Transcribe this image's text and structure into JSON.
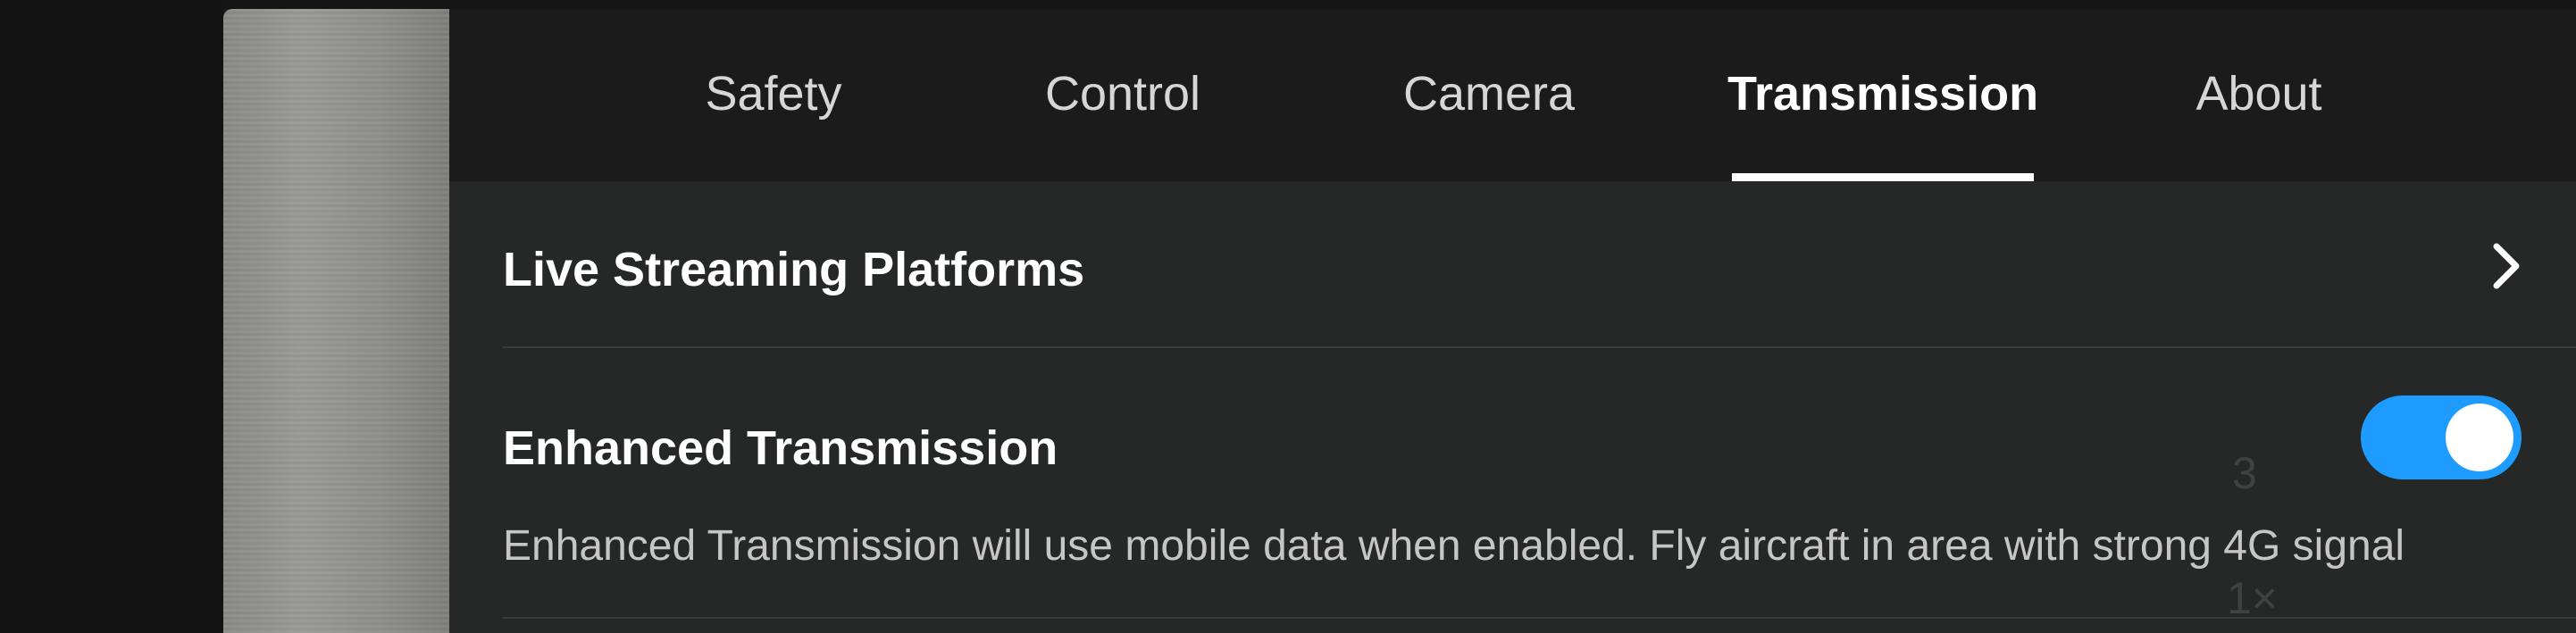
{
  "tabs": [
    {
      "label": "Safety",
      "active": false
    },
    {
      "label": "Control",
      "active": false
    },
    {
      "label": "Camera",
      "active": false
    },
    {
      "label": "Transmission",
      "active": true
    },
    {
      "label": "About",
      "active": false
    }
  ],
  "rows": {
    "live_streaming": {
      "label": "Live Streaming Platforms",
      "icon": "chevron-right-icon"
    },
    "enhanced_transmission": {
      "label": "Enhanced Transmission",
      "enabled": true,
      "description": "Enhanced Transmission will use mobile data when enabled. Fly aircraft in area with strong 4G signal"
    }
  },
  "background_overlay": {
    "number": "3",
    "zoom": "1×"
  },
  "colors": {
    "toggle_on": "#1e9bff",
    "panel_bg": "#262727",
    "tabbar_bg": "#1b1b1b",
    "text_primary": "#ffffff"
  }
}
